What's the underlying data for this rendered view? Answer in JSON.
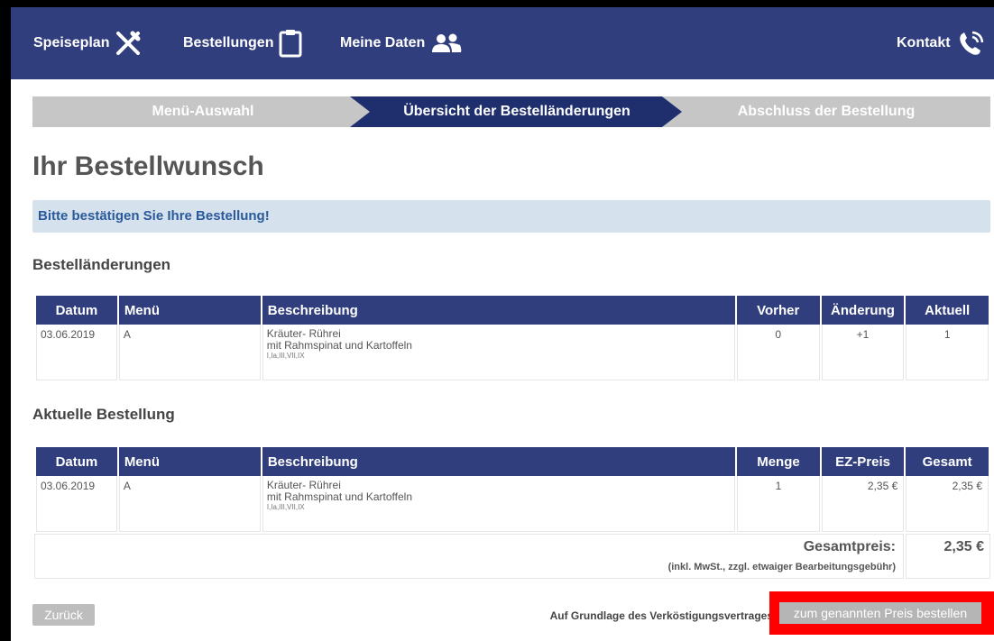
{
  "nav": {
    "items": [
      {
        "label": "Speiseplan",
        "icon": "cutlery-icon"
      },
      {
        "label": "Bestellungen",
        "icon": "clipboard-icon"
      },
      {
        "label": "Meine Daten",
        "icon": "users-icon"
      }
    ],
    "contact": {
      "label": "Kontakt",
      "icon": "phone-icon"
    },
    "color": "#313e7e"
  },
  "steps": [
    {
      "label": "Menü-Auswahl",
      "state": "done"
    },
    {
      "label": "Übersicht der Bestelländerungen",
      "state": "active"
    },
    {
      "label": "Abschluss der Bestellung",
      "state": "pending"
    }
  ],
  "page_title": "Ihr Bestellwunsch",
  "alert": "Bitte bestätigen Sie Ihre Bestellung!",
  "changes": {
    "title": "Bestelländerungen",
    "headers": [
      "Datum",
      "Menü",
      "Beschreibung",
      "Vorher",
      "Änderung",
      "Aktuell"
    ],
    "rows": [
      {
        "date": "03.06.2019",
        "menu": "A",
        "desc_line1": "Kräuter- Rührei",
        "desc_line2": "mit Rahmspinat und Kartoffeln",
        "allergens": "I,Ia,III,VII,IX",
        "before": "0",
        "change": "+1",
        "current": "1"
      }
    ]
  },
  "current_order": {
    "title": "Aktuelle Bestellung",
    "headers": [
      "Datum",
      "Menü",
      "Beschreibung",
      "Menge",
      "EZ-Preis",
      "Gesamt"
    ],
    "rows": [
      {
        "date": "03.06.2019",
        "menu": "A",
        "desc_line1": "Kräuter- Rührei",
        "desc_line2": "mit Rahmspinat und Kartoffeln",
        "allergens": "I,Ia,III,VII,IX",
        "qty": "1",
        "unit_price": "2,35 €",
        "total": "2,35 €"
      }
    ],
    "total_label": "Gesamtpreis:",
    "total_note": "(inkl. MwSt., zzgl. etwaiger Bearbeitungsgebühr)",
    "total_value": "2,35 €"
  },
  "footer": {
    "back_label": "Zurück",
    "note": "Auf Grundlage des Verköstigungsvertrages",
    "order_label": "zum genannten Preis bestellen",
    "highlight_color": "#ff0000"
  }
}
